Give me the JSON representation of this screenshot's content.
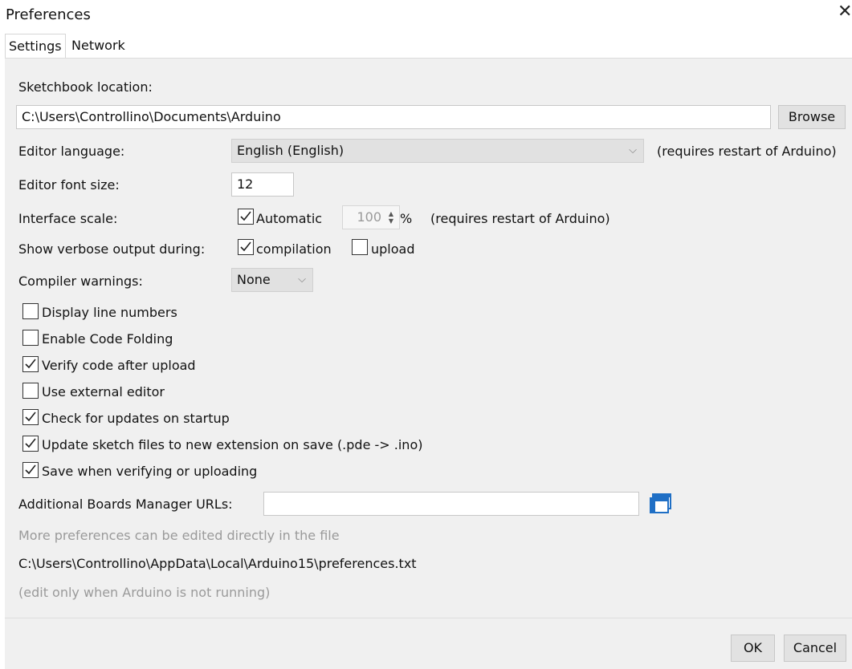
{
  "window": {
    "title": "Preferences",
    "close_glyph": "✕"
  },
  "tabs": [
    {
      "label": "Settings",
      "active": true
    },
    {
      "label": "Network",
      "active": false
    }
  ],
  "sketchbook": {
    "label": "Sketchbook location:",
    "path": "C:\\Users\\Controllino\\Documents\\Arduino",
    "browse_label": "Browse"
  },
  "editor_language": {
    "label": "Editor language:",
    "value": "English (English)",
    "note": "(requires restart of Arduino)"
  },
  "editor_font_size": {
    "label": "Editor font size:",
    "value": "12"
  },
  "interface_scale": {
    "label": "Interface scale:",
    "automatic_label": "Automatic",
    "automatic_checked": true,
    "value": "100",
    "unit": "%",
    "note": "(requires restart of Arduino)"
  },
  "verbose": {
    "label": "Show verbose output during:",
    "compilation_label": "compilation",
    "compilation_checked": true,
    "upload_label": "upload",
    "upload_checked": false
  },
  "compiler_warnings": {
    "label": "Compiler warnings:",
    "value": "None"
  },
  "options": [
    {
      "label": "Display line numbers",
      "checked": false
    },
    {
      "label": "Enable Code Folding",
      "checked": false
    },
    {
      "label": "Verify code after upload",
      "checked": true
    },
    {
      "label": "Use external editor",
      "checked": false
    },
    {
      "label": "Check for updates on startup",
      "checked": true
    },
    {
      "label": "Update sketch files to new extension on save (.pde -> .ino)",
      "checked": true
    },
    {
      "label": "Save when verifying or uploading",
      "checked": true
    }
  ],
  "boards_manager": {
    "label": "Additional Boards Manager URLs:",
    "value": "",
    "icon": "window-list-icon"
  },
  "footer": {
    "more_prefs": "More preferences can be edited directly in the file",
    "prefs_path": "C:\\Users\\Controllino\\AppData\\Local\\Arduino15\\preferences.txt",
    "edit_note": "(edit only when Arduino is not running)"
  },
  "buttons": {
    "ok": "OK",
    "cancel": "Cancel"
  },
  "colors": {
    "panel_bg": "#f0f0f0",
    "button_bg": "#e2e2e2",
    "muted_text": "#9a9a9a",
    "icon_blue": "#1f6fc5"
  }
}
